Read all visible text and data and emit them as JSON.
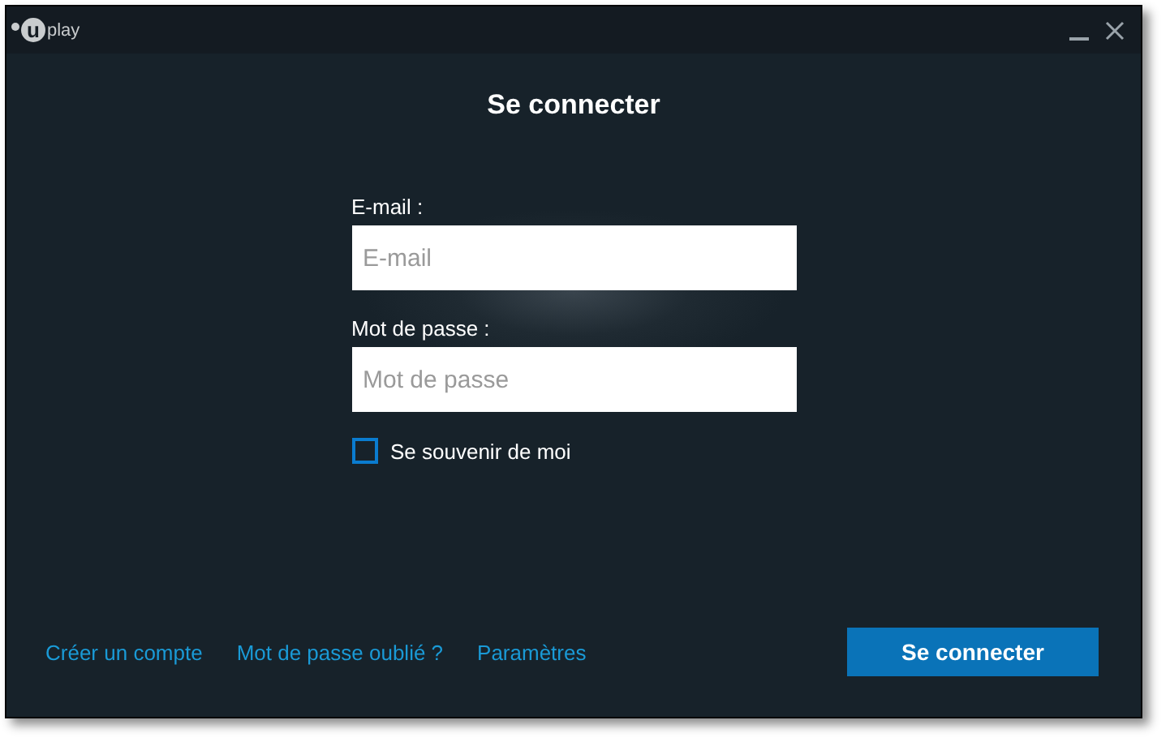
{
  "window": {
    "logo": {
      "mark": "u",
      "text": "play"
    }
  },
  "title": "Se connecter",
  "fields": [
    {
      "label": "E-mail :",
      "placeholder": "E-mail"
    },
    {
      "label": "Mot de passe :",
      "placeholder": "Mot de passe"
    }
  ],
  "remember": {
    "label": "Se souvenir de moi",
    "checked": false
  },
  "links": [
    "Créer un compte",
    "Mot de passe oublié ?",
    "Paramètres"
  ],
  "submit": "Se connecter"
}
